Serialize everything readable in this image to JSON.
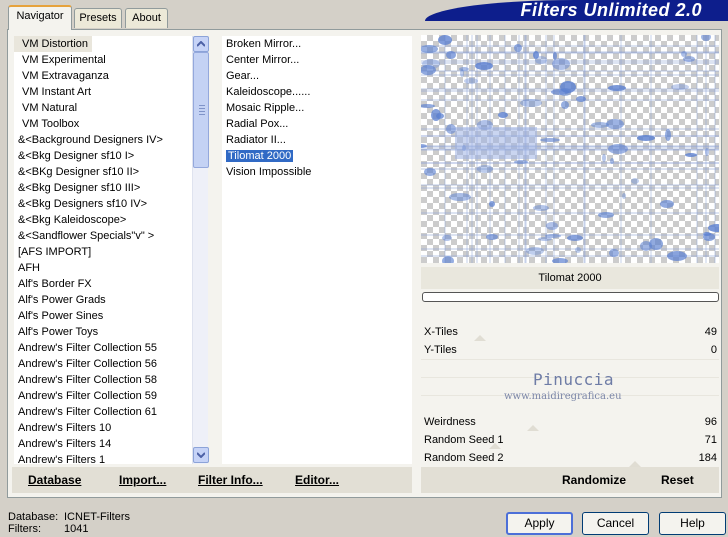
{
  "tabs": [
    "Navigator",
    "Presets",
    "About"
  ],
  "app_title": "Filters Unlimited 2.0",
  "categories": [
    "VM Distortion",
    "VM Experimental",
    "VM Extravaganza",
    "VM Instant Art",
    "VM Natural",
    "VM Toolbox",
    "&<Background Designers IV>",
    "&<Bkg Designer sf10 I>",
    "&<BKg Designer sf10 II>",
    "&<Bkg Designer sf10 III>",
    "&<Bkg Designers sf10 IV>",
    "&<Bkg Kaleidoscope>",
    "&<Sandflower Specials\"v\" >",
    "[AFS IMPORT]",
    "AFH",
    "Alf's Border FX",
    "Alf's Power Grads",
    "Alf's Power Sines",
    "Alf's Power Toys",
    "Andrew's Filter Collection 55",
    "Andrew's Filter Collection 56",
    "Andrew's Filter Collection 58",
    "Andrew's Filter Collection 59",
    "Andrew's Filter Collection 61",
    "Andrew's Filters 10",
    "Andrew's Filters 14",
    "Andrew's Filters 1"
  ],
  "filters": [
    "Broken Mirror...",
    "Center Mirror...",
    "Gear...",
    "Kaleidoscope......",
    "Mosaic Ripple...",
    "Radial Pox...",
    "Radiator II...",
    "Tilomat 2000",
    "Vision Impossible"
  ],
  "selected_filter_name": "Tilomat 2000",
  "params": {
    "x_tiles_label": "X-Tiles",
    "x_tiles_value": "49",
    "y_tiles_label": "Y-Tiles",
    "y_tiles_value": "0",
    "weirdness_label": "Weirdness",
    "weirdness_value": "96",
    "seed1_label": "Random Seed 1",
    "seed1_value": "71",
    "seed2_label": "Random Seed 2",
    "seed2_value": "184"
  },
  "watermark": {
    "line1": "Pinuccia",
    "line2": "www.maidiregrafica.eu"
  },
  "actions": {
    "database": "Database",
    "import": "Import...",
    "filter_info": "Filter Info...",
    "editor": "Editor...",
    "randomize": "Randomize",
    "reset": "Reset"
  },
  "footer": {
    "database_label": "Database:",
    "database_value": "ICNET-Filters",
    "filters_label": "Filters:",
    "filters_value": "1041"
  },
  "buttons": {
    "apply": "Apply",
    "cancel": "Cancel",
    "help": "Help"
  },
  "colors": {
    "banner": "#0d1e8c",
    "selection": "#316ac5",
    "panel": "#f4f3ee",
    "preview_blue": "#5b80d0"
  }
}
